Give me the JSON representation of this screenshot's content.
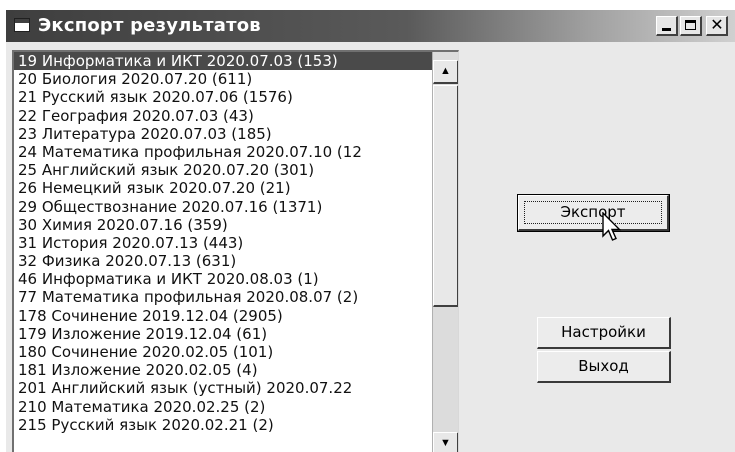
{
  "window": {
    "title": "Экспорт результатов",
    "controls": {
      "minimize": "minimize-icon",
      "maximize": "maximize-icon",
      "close_glyph": "✕"
    }
  },
  "results_list": {
    "selected_index": 0,
    "items": [
      "19 Информатика и ИКТ 2020.07.03 (153)",
      "20 Биология 2020.07.20 (611)",
      "21 Русский язык 2020.07.06 (1576)",
      "22 География 2020.07.03 (43)",
      "23 Литература 2020.07.03 (185)",
      "24 Математика профильная 2020.07.10 (12",
      "25 Английский язык 2020.07.20 (301)",
      "26 Немецкий язык 2020.07.20 (21)",
      "29 Обществознание 2020.07.16 (1371)",
      "30 Химия 2020.07.16 (359)",
      "31 История 2020.07.13 (443)",
      "32 Физика 2020.07.13 (631)",
      "46 Информатика и ИКТ 2020.08.03 (1)",
      "77 Математика профильная 2020.08.07 (2)",
      "178 Сочинение 2019.12.04 (2905)",
      "179 Изложение 2019.12.04 (61)",
      "180 Сочинение 2020.02.05 (101)",
      "181 Изложение 2020.02.05 (4)",
      "201 Английский язык (устный) 2020.07.22",
      "210 Математика 2020.02.25 (2)",
      "215 Русский язык 2020.02.21 (2)"
    ]
  },
  "scrollbar": {
    "up_glyph": "▲",
    "down_glyph": "▼"
  },
  "buttons": {
    "export_label": "Экспорт",
    "settings_label": "Настройки",
    "exit_label": "Выход"
  },
  "colors": {
    "title_bar": "#3e3e3e",
    "selection": "#4a4a4a",
    "window_bg": "#e9e9e9"
  }
}
